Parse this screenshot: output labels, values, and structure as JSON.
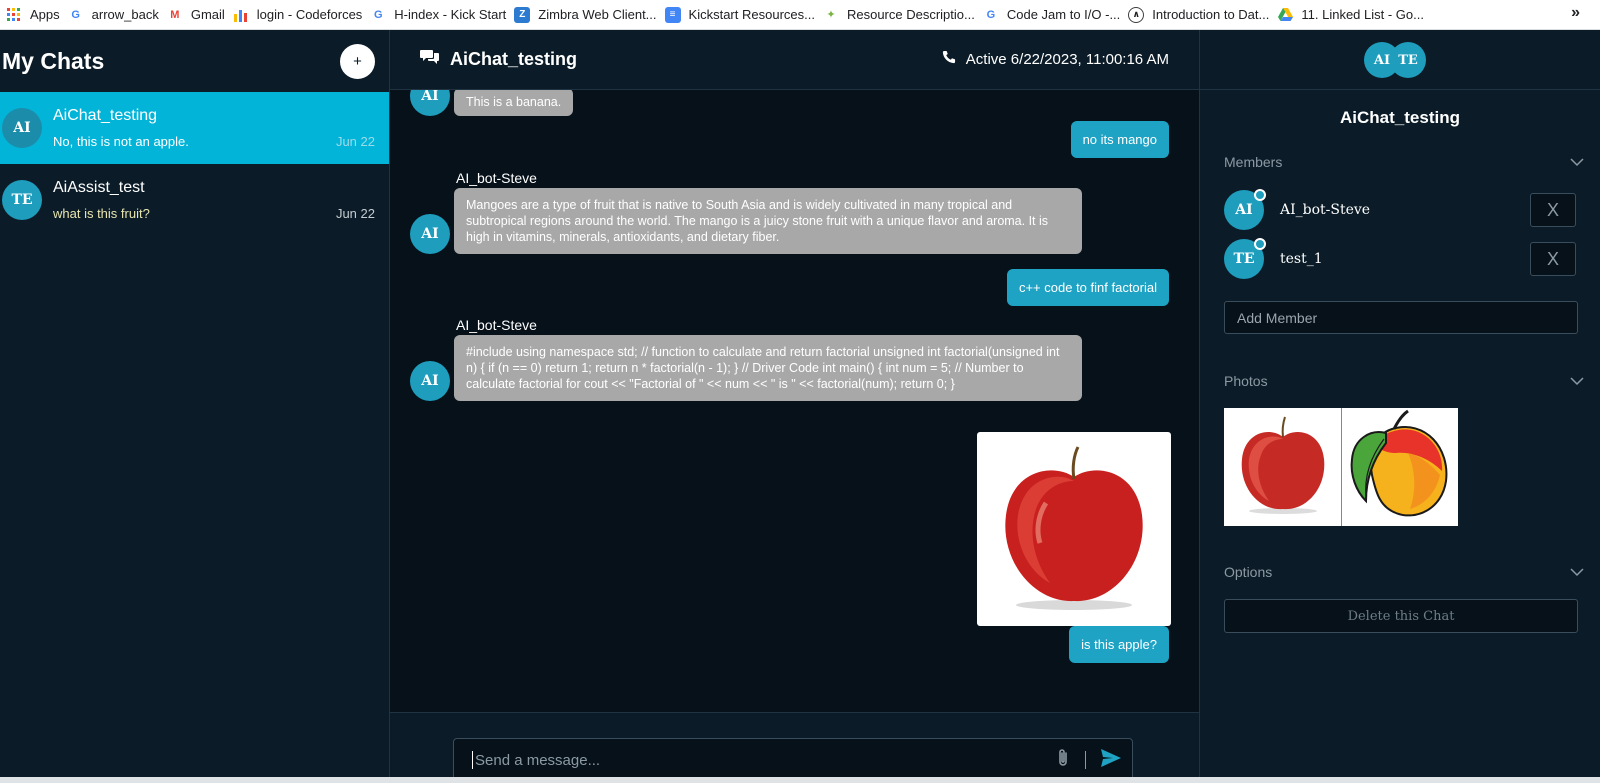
{
  "bookmarks": [
    {
      "label": "Apps",
      "icon": "apps-grid-icon"
    },
    {
      "label": "arrow_back",
      "icon": "google-icon"
    },
    {
      "label": "Gmail",
      "icon": "gmail-icon"
    },
    {
      "label": "login - Codeforces",
      "icon": "codeforces-icon"
    },
    {
      "label": "H-index - Kick Start",
      "icon": "google-icon"
    },
    {
      "label": "Zimbra Web Client...",
      "icon": "zimbra-icon"
    },
    {
      "label": "Kickstart Resources...",
      "icon": "docs-icon"
    },
    {
      "label": "Resource Descriptio...",
      "icon": "runner-icon"
    },
    {
      "label": "Code Jam to I/O -...",
      "icon": "google-icon"
    },
    {
      "label": "Introduction to Dat...",
      "icon": "course-icon"
    },
    {
      "label": "11. Linked List - Go...",
      "icon": "drive-icon"
    }
  ],
  "bookmarks_more": "»",
  "sidebar": {
    "title": "My Chats",
    "add_label": "+",
    "chats": [
      {
        "initials": "AI",
        "name": "AiChat_testing",
        "last_message": "No, this is not an apple.",
        "date": "Jun 22",
        "active": true
      },
      {
        "initials": "TE",
        "name": "AiAssist_test",
        "last_message": "what is this fruit?",
        "date": "Jun 22",
        "active": false
      }
    ]
  },
  "chat": {
    "title": "AiChat_testing",
    "status": "Active 6/22/2023, 11:00:16 AM",
    "messages": {
      "m0": {
        "initials": "AI",
        "text": "This is a banana."
      },
      "m1": {
        "text": "no its mango"
      },
      "m2": {
        "sender": "AI_bot-Steve",
        "initials": "AI",
        "text": "Mangoes are a type of fruit that is native to South Asia and is widely cultivated in many tropical and subtropical regions around the world. The mango is a juicy stone fruit with a unique flavor and aroma. It is high in vitamins, minerals, antioxidants, and dietary fiber."
      },
      "m3": {
        "text": "c++ code to finf factorial"
      },
      "m4": {
        "sender": "AI_bot-Steve",
        "initials": "AI",
        "text": "#include using namespace std; // function to calculate and return factorial unsigned int factorial(unsigned int n) { if (n == 0) return 1; return n * factorial(n - 1); } // Driver Code int main() { int num = 5; // Number to calculate factorial for cout << \"Factorial of \" << num << \" is \" << factorial(num); return 0; }"
      },
      "m5": {
        "image": "apple-photo"
      },
      "m6": {
        "text": "is this apple?"
      }
    },
    "composer_placeholder": "Send a message..."
  },
  "details": {
    "avatars": [
      "AI",
      "TE"
    ],
    "title": "AiChat_testing",
    "members_label": "Members",
    "members": [
      {
        "initials": "AI",
        "name": "AI_bot-Steve",
        "remove_label": "X"
      },
      {
        "initials": "TE",
        "name": "test_1",
        "remove_label": "X"
      }
    ],
    "add_member_placeholder": "Add Member",
    "photos_label": "Photos",
    "photos": [
      "apple-photo",
      "mango-photo"
    ],
    "options_label": "Options",
    "delete_label": "Delete this Chat"
  },
  "colors": {
    "accent": "#03b4d9",
    "avatar": "#1e9dbd",
    "outgoing_bubble": "#1fa3c4",
    "incoming_bubble": "#a8a8a8",
    "background": "#06111a",
    "panel": "#0b1c28"
  }
}
